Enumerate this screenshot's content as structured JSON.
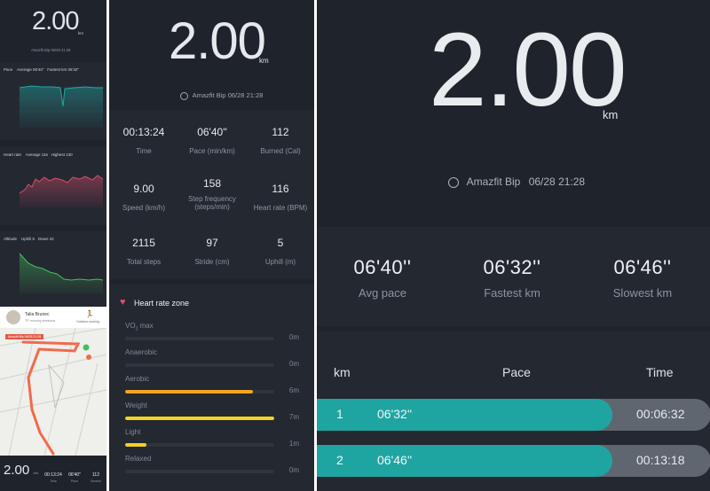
{
  "colors": {
    "bg": "#1f232b",
    "card": "#242830",
    "teal": "#20a7a3",
    "orange": "#f3a423",
    "yellow": "#f2d31f",
    "pink": "#d74c6c",
    "green": "#42c15b",
    "route": "#f26a4a",
    "gray_bar": "#5f6670"
  },
  "left": {
    "distance": "2.00",
    "distance_unit": "km",
    "device_line": "Amazfit Bip 06/28 21:28",
    "pace_chart": {
      "title": "Pace",
      "average": "Average 06'40\"",
      "fastest": "Fastest km 06'32\""
    },
    "heart_chart": {
      "title": "Heart rate",
      "average": "Average 116",
      "highest": "Highest 130"
    },
    "altitude_chart": {
      "title": "Altitude",
      "uphill": "Uphill 5",
      "down": "Down 22"
    },
    "map_card": {
      "user_name": "Talia Brunec",
      "subtitle": "TP running sessions",
      "mode": "Outdoor running",
      "badge": "Amazfit Bip 06/28 21:28"
    },
    "mini_stats": [
      {
        "value": "2.00",
        "label": "km"
      },
      {
        "value": "00:13:24",
        "label": "Time"
      },
      {
        "value": "06'40\"",
        "label": "Pace"
      },
      {
        "value": "112",
        "label": "Burned"
      }
    ]
  },
  "middle": {
    "distance": "2.00",
    "distance_unit": "km",
    "device": "Amazfit Bip",
    "datetime": "06/28 21:28",
    "stats": [
      {
        "value": "00:13:24",
        "label": "Time"
      },
      {
        "value": "06'40''",
        "label": "Pace (min/km)"
      },
      {
        "value": "112",
        "label": "Burned (Cal)"
      },
      {
        "value": "9.00",
        "label": "Speed (km/h)"
      },
      {
        "value": "158",
        "label": "Step frequency (steps/min)"
      },
      {
        "value": "116",
        "label": "Heart rate (BPM)"
      },
      {
        "value": "2115",
        "label": "Total steps"
      },
      {
        "value": "97",
        "label": "Stride (cm)"
      },
      {
        "value": "5",
        "label": "Uphill (m)"
      }
    ],
    "zone_title": "Heart rate zone",
    "zones": [
      {
        "name": "VO2 max",
        "time": "0m",
        "fraction": 0.0,
        "color": "#2f343d"
      },
      {
        "name": "Anaerobic",
        "time": "0m",
        "fraction": 0.0,
        "color": "#2f343d"
      },
      {
        "name": "Aerobic",
        "time": "6m",
        "fraction": 0.86,
        "color": "#f3a423"
      },
      {
        "name": "Weight",
        "time": "7m",
        "fraction": 1.0,
        "color": "#f2d31f"
      },
      {
        "name": "Light",
        "time": "1m",
        "fraction": 0.14,
        "color": "#f2d31f"
      },
      {
        "name": "Relaxed",
        "time": "0m",
        "fraction": 0.0,
        "color": "#2f343d"
      }
    ]
  },
  "right": {
    "distance": "2.00",
    "distance_unit": "km",
    "device": "Amazfit Bip",
    "datetime": "06/28 21:28",
    "summary": [
      {
        "value": "06'40''",
        "label": "Avg pace"
      },
      {
        "value": "06'32''",
        "label": "Fastest km"
      },
      {
        "value": "06'46''",
        "label": "Slowest km"
      }
    ],
    "headers": {
      "km": "km",
      "pace": "Pace",
      "time": "Time"
    },
    "splits": [
      {
        "km": "1",
        "pace": "06'32''",
        "time": "00:06:32",
        "fraction": 0.75
      },
      {
        "km": "2",
        "pace": "06'46''",
        "time": "00:13:18",
        "fraction": 0.75
      }
    ]
  }
}
